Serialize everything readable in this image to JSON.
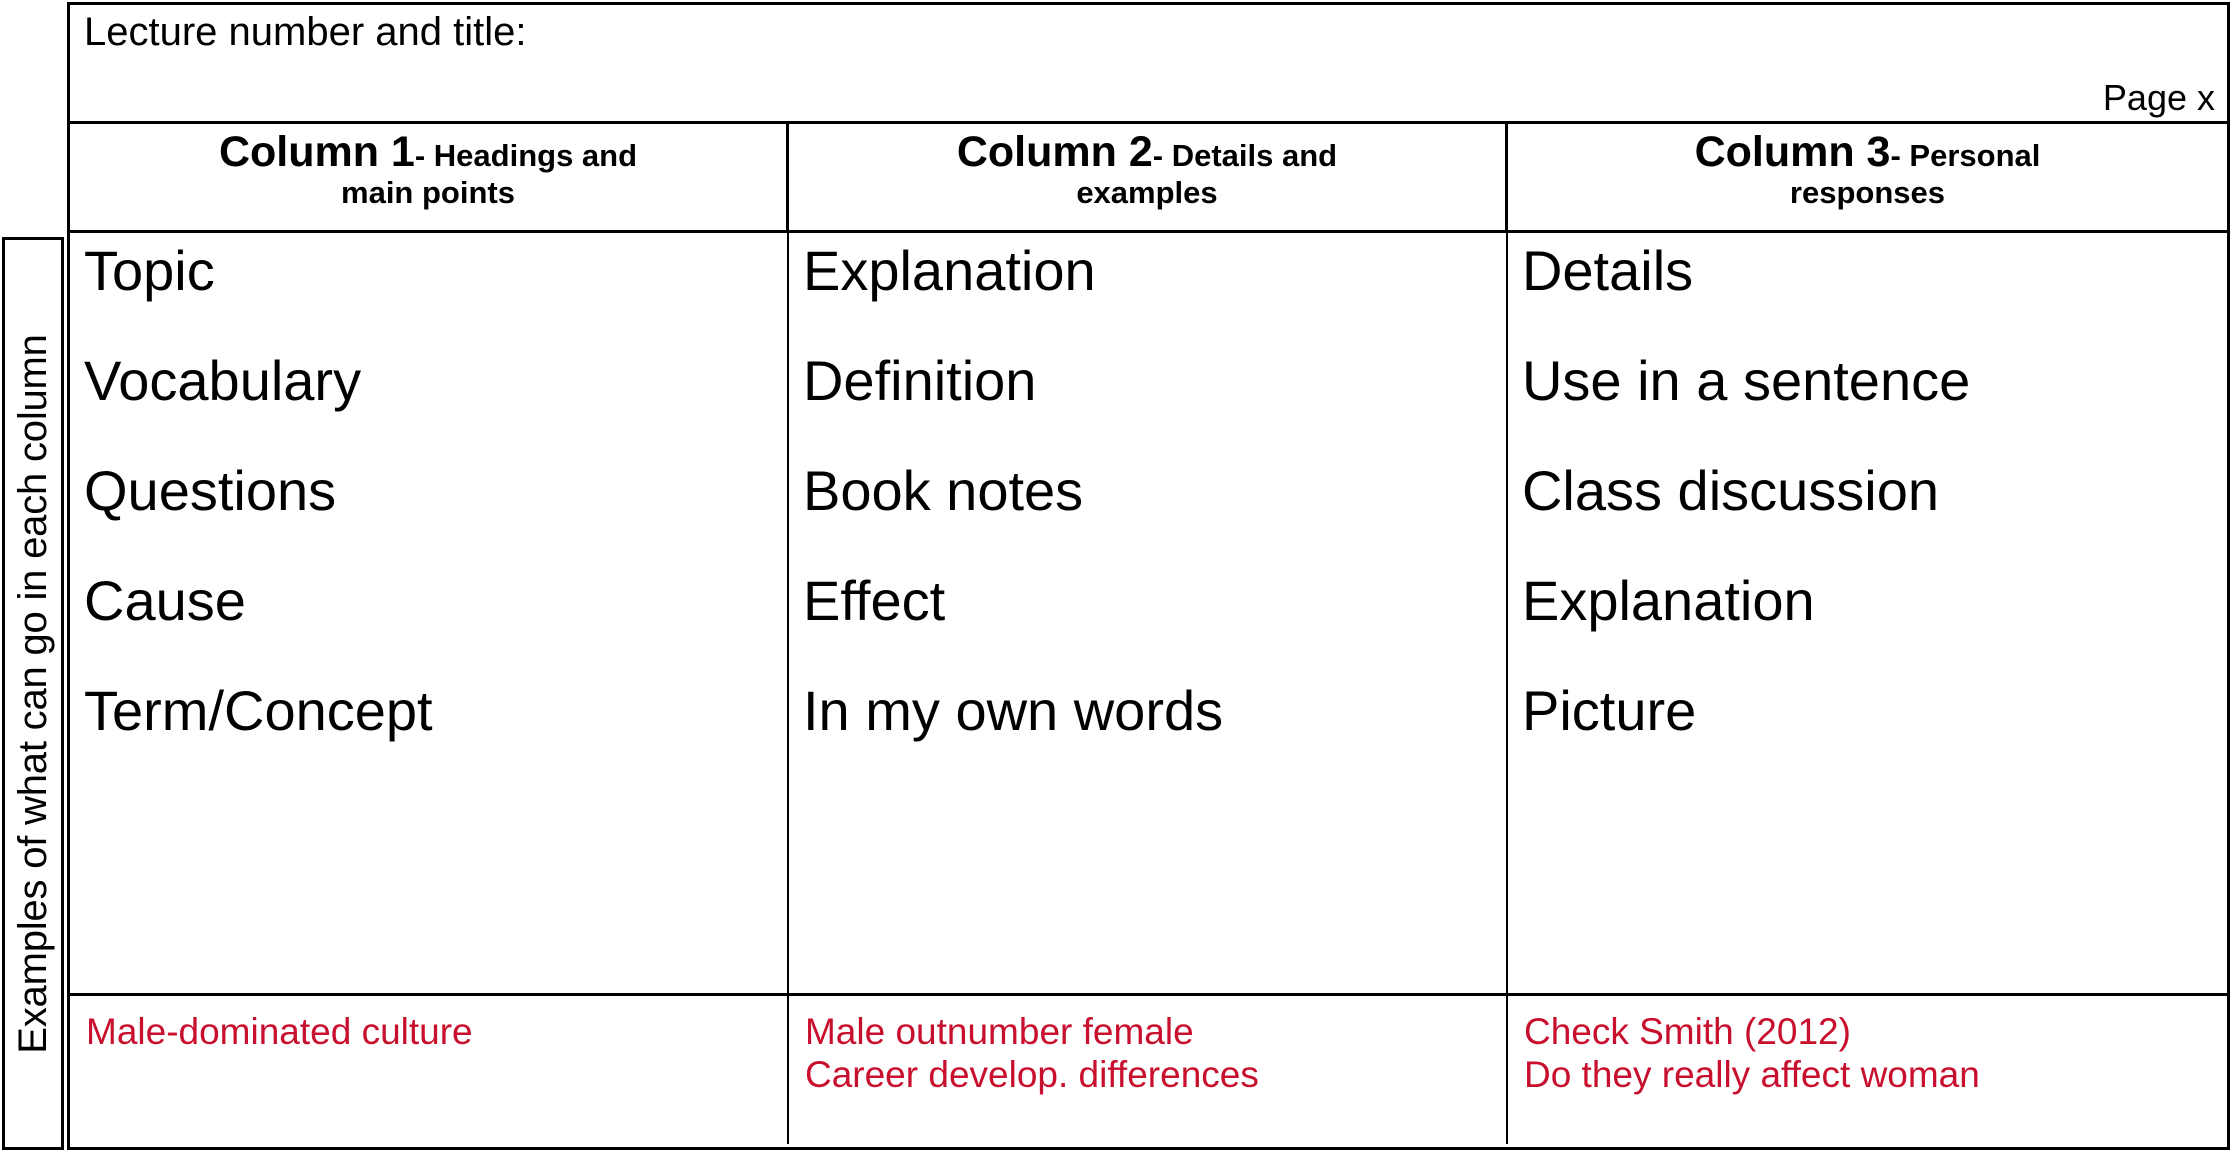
{
  "sheet": {
    "side_label": "Examples of what can go in each column",
    "title": "Lecture number and title:",
    "page_label": "Page x",
    "accent_red": "#C8102E",
    "border_color": "#000000",
    "background": "#FFFFFF"
  },
  "columns": [
    {
      "number": "Column 1",
      "descriptor_line1": "- Headings and",
      "descriptor_line2": "main points"
    },
    {
      "number": "Column 2",
      "descriptor_line1": "- Details and",
      "descriptor_line2": "examples"
    },
    {
      "number": "Column 3",
      "descriptor_line1": "- Personal",
      "descriptor_line2": "responses"
    }
  ],
  "examples": {
    "col1": [
      "Topic",
      "Vocabulary",
      "Questions",
      "Cause",
      "Term/Concept"
    ],
    "col2": [
      "Explanation",
      "Definition",
      "Book notes",
      "Effect",
      "In my own words"
    ],
    "col3": [
      "Details",
      "Use in a sentence",
      "Class discussion",
      "Explanation",
      "Picture"
    ]
  },
  "notes": {
    "col1": [
      "Male-dominated culture",
      ""
    ],
    "col2": [
      "Male outnumber female",
      "Career develop. differences"
    ],
    "col3": [
      "Check Smith (2012)",
      "Do they really affect woman"
    ]
  }
}
